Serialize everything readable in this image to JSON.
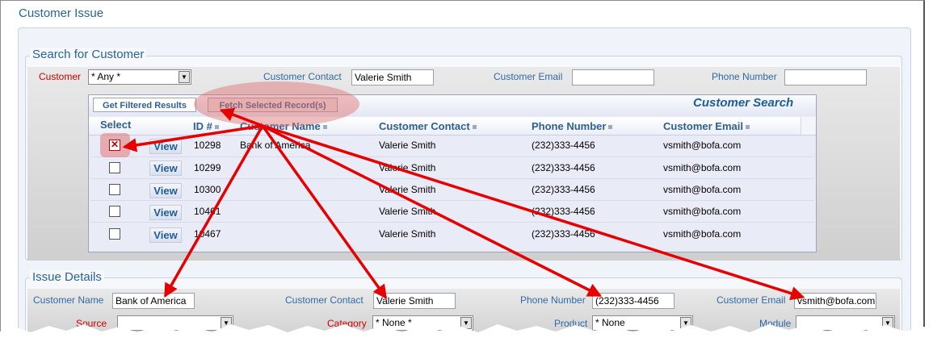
{
  "page": {
    "title": "Customer Issue"
  },
  "search": {
    "title": "Search for Customer",
    "customer_label": "Customer",
    "customer_value": "* Any *",
    "contact_label": "Customer Contact",
    "contact_value": "Valerie Smith",
    "email_label": "Customer Email",
    "email_value": "",
    "phone_label": "Phone Number",
    "phone_value": ""
  },
  "grid": {
    "title": "Customer Search",
    "get_filtered_label": "Get Filtered Results",
    "fetch_selected_label": "Fetch Selected Record(s)",
    "view_label": "View",
    "columns": [
      "Select",
      "ID #",
      "Customer Name",
      "Customer Contact",
      "Phone Number",
      "Customer Email"
    ],
    "rows": [
      {
        "checked": true,
        "id": "10298",
        "name": "Bank of America",
        "contact": "Valerie Smith",
        "phone": "(232)333-4456",
        "email": "vsmith@bofa.com"
      },
      {
        "checked": false,
        "id": "10299",
        "name": "",
        "contact": "Valerie Smith",
        "phone": "(232)333-4456",
        "email": "vsmith@bofa.com"
      },
      {
        "checked": false,
        "id": "10300",
        "name": "",
        "contact": "Valerie Smith",
        "phone": "(232)333-4456",
        "email": "vsmith@bofa.com"
      },
      {
        "checked": false,
        "id": "10461",
        "name": "",
        "contact": "Valerie Smith",
        "phone": "(232)333-4456",
        "email": "vsmith@bofa.com"
      },
      {
        "checked": false,
        "id": "10467",
        "name": "",
        "contact": "Valerie Smith",
        "phone": "(232)333-4456",
        "email": "vsmith@bofa.com"
      }
    ]
  },
  "issue": {
    "title": "Issue Details",
    "name_label": "Customer Name",
    "name_value": "Bank of America",
    "contact_label": "Customer Contact",
    "contact_value": "Valerie Smith",
    "phone_label": "Phone Number",
    "phone_value": "(232)333-4456",
    "email_label": "Customer Email",
    "email_value": "vsmith@bofa.com",
    "source_label": "Source",
    "category_label": "Category",
    "category_value": "* None *",
    "product_label": "Product",
    "product_value": "* None",
    "module_label": "Module"
  },
  "colors": {
    "accent": "#2a6496",
    "required": "#cc0000",
    "arrow": "#e60000",
    "highlight": "#e88c8c"
  }
}
